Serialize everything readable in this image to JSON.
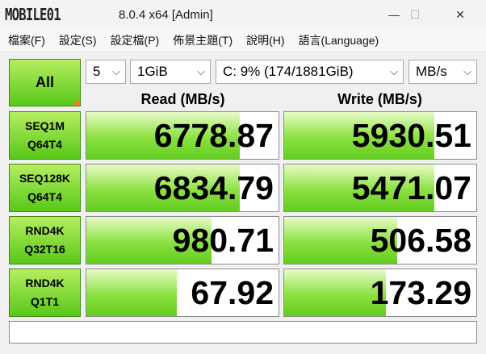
{
  "window": {
    "logo_text": "MOBILE01",
    "title": "8.0.4 x64 [Admin]",
    "minimize_glyph": "—",
    "maximize_glyph": "☐",
    "close_glyph": "✕"
  },
  "menu": [
    "檔案(F)",
    "設定(S)",
    "設定檔(P)",
    "佈景主題(T)",
    "說明(H)",
    "語言(Language)"
  ],
  "controls": {
    "all_label": "All",
    "count": "5",
    "size": "1GiB",
    "drive": "C: 9% (174/1881GiB)",
    "unit": "MB/s",
    "chevron": "⌵"
  },
  "headers": {
    "read": "Read (MB/s)",
    "write": "Write (MB/s)"
  },
  "tests": [
    {
      "line1": "SEQ1M",
      "line2": "Q64T4",
      "read": "6778.87",
      "write": "5930.51",
      "read_fill": 0.8,
      "write_fill": 0.78
    },
    {
      "line1": "SEQ128K",
      "line2": "Q64T4",
      "read": "6834.79",
      "write": "5471.07",
      "read_fill": 0.8,
      "write_fill": 0.78
    },
    {
      "line1": "RND4K",
      "line2": "Q32T16",
      "read": "980.71",
      "write": "506.58",
      "read_fill": 0.65,
      "write_fill": 0.59
    },
    {
      "line1": "RND4K",
      "line2": "Q1T1",
      "read": "67.92",
      "write": "173.29",
      "read_fill": 0.47,
      "write_fill": 0.53
    }
  ],
  "status": ""
}
